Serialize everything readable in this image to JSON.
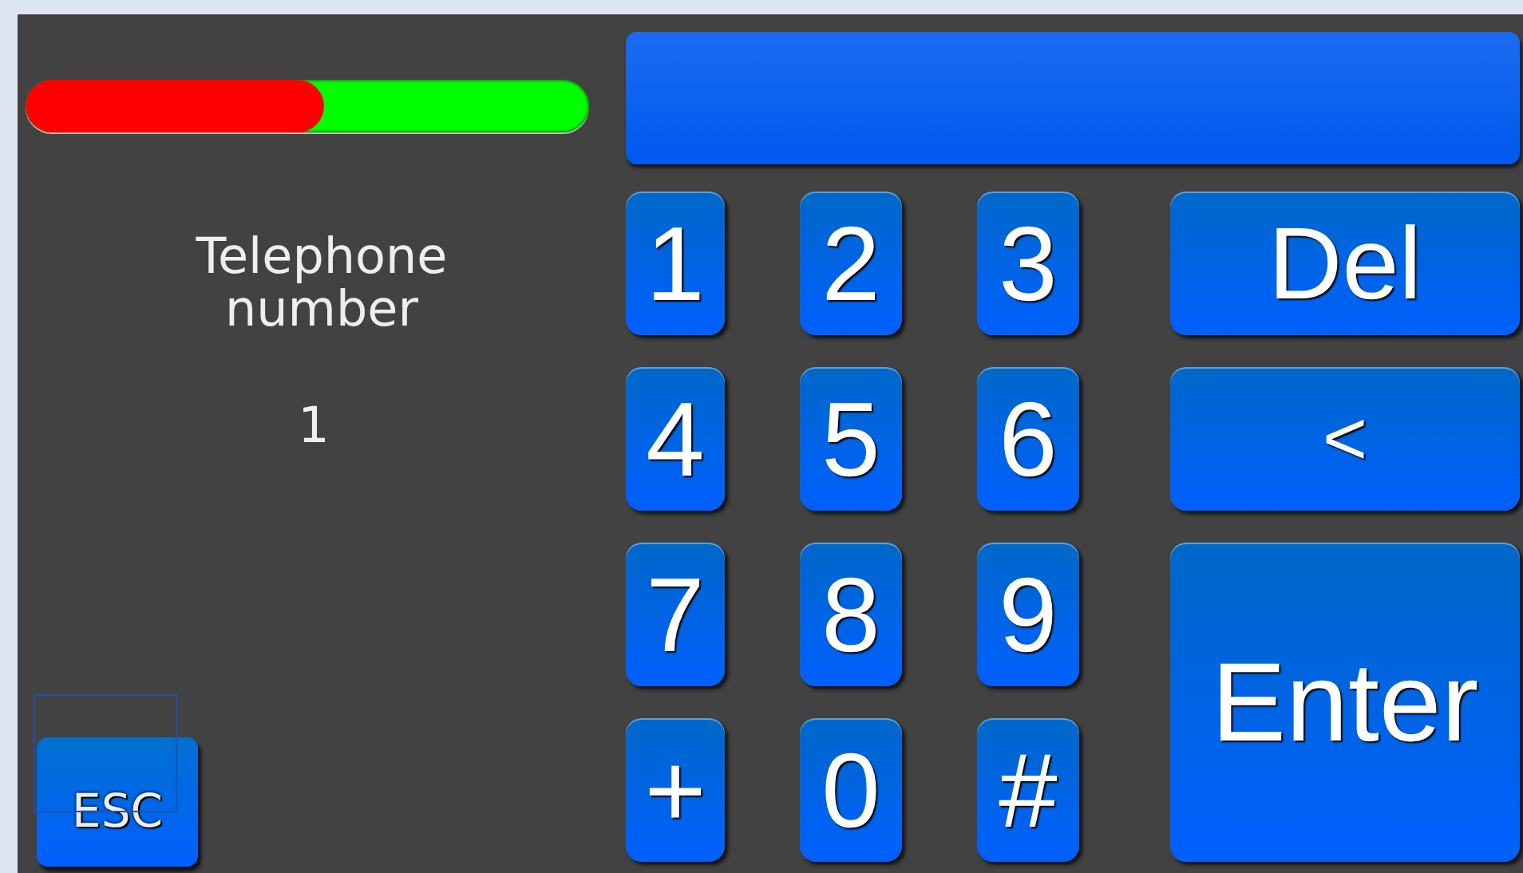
{
  "progress": {
    "level": 0.53
  },
  "prompt": {
    "label": "Telephone number",
    "value": "1"
  },
  "keypad": {
    "digits": [
      "1",
      "2",
      "3",
      "4",
      "5",
      "6",
      "7",
      "8",
      "9",
      "+",
      "0",
      "#"
    ],
    "actions": [
      {
        "label": "Del",
        "kind": "delete"
      },
      {
        "label": "<",
        "kind": "back"
      },
      {
        "label": "Enter",
        "kind": "enter"
      }
    ]
  },
  "escape": {
    "label": "ESC"
  }
}
